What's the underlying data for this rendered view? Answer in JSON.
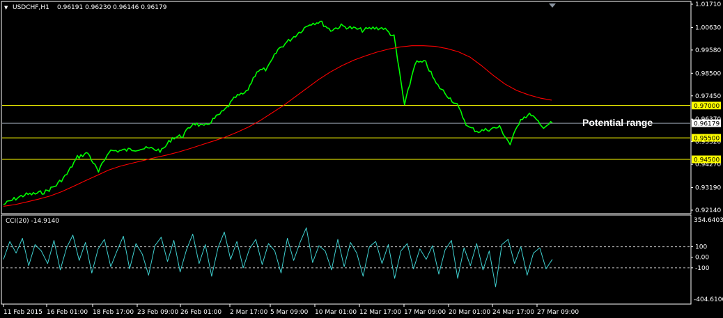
{
  "header": {
    "symbol": "USDCHF,H1",
    "ohlc": "0.96191 0.96230 0.96146 0.96179",
    "dropdown_glyph": "▼"
  },
  "indicator": {
    "label": "CCI(20) -14.9140",
    "scale_max": "354.6403",
    "scale_min": "-404.6100"
  },
  "annotation": "Potential range",
  "colors": {
    "background": "#000000",
    "price": "#00ff00",
    "ma": "#ff0000",
    "level": "#ffff00",
    "cci": "#3fd0d0",
    "grid": "#ffffff",
    "current": "#9aa4b0"
  },
  "chart_data": [
    {
      "type": "line",
      "panel": "price",
      "title": "USDCHF,H1",
      "ylim": [
        0.9214,
        1.0171
      ],
      "price_ticks": [
        "1.01710",
        "1.00630",
        "0.99580",
        "0.98500",
        "0.97450",
        "0.96370",
        "0.95320",
        "0.94270",
        "0.93190",
        "0.92140"
      ],
      "x_tick_labels": [
        "11 Feb 2015",
        "16 Feb 01:00",
        "18 Feb 17:00",
        "23 Feb 09:00",
        "26 Feb 01:00",
        "2 Mar 17:00",
        "5 Mar 09:00",
        "10 Mar 01:00",
        "12 Mar 17:00",
        "17 Mar 09:00",
        "20 Mar 01:00",
        "24 Mar 17:00",
        "27 Mar 09:00"
      ],
      "levels": [
        {
          "label": "0.97000",
          "value": 0.97
        },
        {
          "label": "0.95500",
          "value": 0.955
        },
        {
          "label": "0.94500",
          "value": 0.945
        }
      ],
      "current_price": {
        "label": "0.96179",
        "value": 0.96179
      },
      "series": [
        {
          "values": [
            0.924,
            0.9265,
            0.9285,
            0.929,
            0.93,
            0.933,
            0.938,
            0.946,
            0.948,
            0.939,
            0.949,
            0.949,
            0.9495,
            0.95,
            0.95,
            0.949,
            0.955,
            0.956,
            0.962,
            0.96,
            0.964,
            0.968,
            0.974,
            0.976,
            0.986,
            0.987,
            0.996,
            1.0,
            1.004,
            1.008,
            1.009,
            1.005,
            1.007,
            1.006,
            1.005,
            1.006,
            1.006,
            1.002,
            0.97,
            0.99,
            0.99,
            0.98,
            0.975,
            0.97,
            0.96,
            0.958,
            0.959,
            0.96,
            0.952,
            0.964,
            0.966,
            0.96,
            0.962
          ]
        },
        {
          "values": [
            0.9232,
            0.924,
            0.9252,
            0.9265,
            0.928,
            0.93,
            0.9325,
            0.935,
            0.9375,
            0.94,
            0.9418,
            0.9432,
            0.9445,
            0.9458,
            0.947,
            0.9484,
            0.95,
            0.9518,
            0.9535,
            0.9553,
            0.9575,
            0.96,
            0.963,
            0.9665,
            0.97,
            0.974,
            0.978,
            0.982,
            0.9855,
            0.9885,
            0.991,
            0.993,
            0.9948,
            0.9962,
            0.9972,
            0.9978,
            0.9978,
            0.9975,
            0.9965,
            0.995,
            0.9925,
            0.9885,
            0.984,
            0.98,
            0.977,
            0.975,
            0.9735,
            0.9725
          ]
        }
      ]
    },
    {
      "type": "line",
      "panel": "indicator",
      "title": "CCI(20) -14.9140",
      "ylim": [
        -404.61,
        354.6403
      ],
      "ticks": [
        "100",
        "0.00",
        "-100"
      ],
      "reference_lines": [
        100,
        -100
      ],
      "series": [
        {
          "values": [
            -20,
            150,
            40,
            180,
            -80,
            120,
            60,
            -60,
            160,
            -120,
            90,
            210,
            -30,
            140,
            -150,
            80,
            170,
            -90,
            60,
            200,
            -110,
            130,
            30,
            -170,
            110,
            190,
            -40,
            160,
            -140,
            70,
            220,
            -60,
            120,
            -180,
            90,
            240,
            -20,
            150,
            -100,
            80,
            170,
            -70,
            130,
            60,
            -150,
            180,
            -30,
            140,
            280,
            -50,
            110,
            60,
            -120,
            170,
            -90,
            140,
            40,
            -180,
            100,
            150,
            -60,
            120,
            -200,
            60,
            130,
            -110,
            80,
            -20,
            110,
            -160,
            70,
            160,
            -200,
            90,
            -80,
            130,
            -120,
            60,
            -280,
            120,
            170,
            -60,
            100,
            -170,
            40,
            90,
            -110,
            -20
          ]
        }
      ]
    }
  ]
}
